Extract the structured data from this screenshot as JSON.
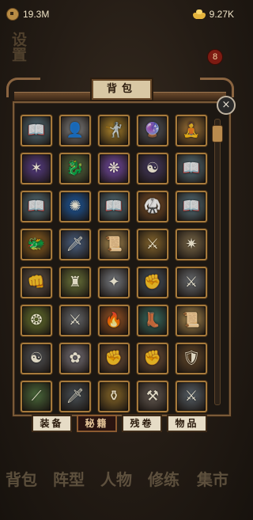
{
  "currency": {
    "copper": {
      "value": "19.3M",
      "icon": "copper-coin-icon"
    },
    "gold": {
      "value": "9.27K",
      "icon": "gold-ingot-icon"
    }
  },
  "background": {
    "left_label": "设置",
    "badge_count": "8"
  },
  "window": {
    "title": "背包",
    "close_glyph": "×"
  },
  "items": [
    {
      "icon": "open-book-icon",
      "glyph": "📖",
      "color": "#5e7b86"
    },
    {
      "icon": "white-figure-icon",
      "glyph": "👤",
      "color": "#8a8a8a"
    },
    {
      "icon": "dancing-warrior-icon",
      "glyph": "🤺",
      "color": "#b58b2e"
    },
    {
      "icon": "crystal-orb-icon",
      "glyph": "🔮",
      "color": "#5b5d63"
    },
    {
      "icon": "meditating-monk-icon",
      "glyph": "🧘",
      "color": "#a87a3a"
    },
    {
      "icon": "purple-claw-icon",
      "glyph": "✶",
      "color": "#5a3f8a"
    },
    {
      "icon": "green-dragon-icon",
      "glyph": "🐉",
      "color": "#5e7448"
    },
    {
      "icon": "purple-wings-icon",
      "glyph": "❋",
      "color": "#7a4fae"
    },
    {
      "icon": "dark-figure-icon",
      "glyph": "☯",
      "color": "#4a3e66"
    },
    {
      "icon": "open-book-icon",
      "glyph": "📖",
      "color": "#5e7b86"
    },
    {
      "icon": "open-book-icon",
      "glyph": "📖",
      "color": "#5e7b86"
    },
    {
      "icon": "blue-energy-icon",
      "glyph": "✺",
      "color": "#1f5ea8"
    },
    {
      "icon": "open-book-icon",
      "glyph": "📖",
      "color": "#5e7b86"
    },
    {
      "icon": "kicking-fighter-icon",
      "glyph": "🥋",
      "color": "#8a5a2e"
    },
    {
      "icon": "open-book-icon",
      "glyph": "📖",
      "color": "#5e7b86"
    },
    {
      "icon": "golden-dragon-icon",
      "glyph": "🐲",
      "color": "#9a6a24"
    },
    {
      "icon": "blue-sword-icon",
      "glyph": "🗡",
      "color": "#4d6384"
    },
    {
      "icon": "scroll-icon",
      "glyph": "📜",
      "color": "#b89658"
    },
    {
      "icon": "golden-warrior-icon",
      "glyph": "⚔",
      "color": "#8a6a30"
    },
    {
      "icon": "sword-burst-icon",
      "glyph": "✷",
      "color": "#7c6a4a"
    },
    {
      "icon": "shadow-fighter-icon",
      "glyph": "👊",
      "color": "#6b5d50"
    },
    {
      "icon": "jade-idol-icon",
      "glyph": "♜",
      "color": "#6f7a3e"
    },
    {
      "icon": "white-slash-icon",
      "glyph": "✦",
      "color": "#7a7e84"
    },
    {
      "icon": "steel-fist-icon",
      "glyph": "✊",
      "color": "#505c68"
    },
    {
      "icon": "crossed-swords-icon",
      "glyph": "⚔",
      "color": "#6b6e72"
    },
    {
      "icon": "green-emblem-icon",
      "glyph": "❂",
      "color": "#6c7a32"
    },
    {
      "icon": "crossed-swords-icon",
      "glyph": "⚔",
      "color": "#6b6e72"
    },
    {
      "icon": "fire-hand-icon",
      "glyph": "🔥",
      "color": "#a35a28"
    },
    {
      "icon": "jade-boot-icon",
      "glyph": "👢",
      "color": "#3c7468"
    },
    {
      "icon": "scroll-icon",
      "glyph": "📜",
      "color": "#b89658"
    },
    {
      "icon": "yin-yang-icon",
      "glyph": "☯",
      "color": "#55575a"
    },
    {
      "icon": "white-lotus-icon",
      "glyph": "✿",
      "color": "#7d7880"
    },
    {
      "icon": "clenched-fist-icon",
      "glyph": "✊",
      "color": "#7a5a40"
    },
    {
      "icon": "clenched-fist-icon",
      "glyph": "✊",
      "color": "#7a5a40"
    },
    {
      "icon": "armored-warrior-icon",
      "glyph": "🛡",
      "color": "#6a4e2e"
    },
    {
      "icon": "green-blade-icon",
      "glyph": "⟋",
      "color": "#4b6a3c"
    },
    {
      "icon": "ornate-sword-icon",
      "glyph": "🗡",
      "color": "#4a5258"
    },
    {
      "icon": "golden-vessel-icon",
      "glyph": "⚱",
      "color": "#8a6a2a"
    },
    {
      "icon": "war-hammer-icon",
      "glyph": "⚒",
      "color": "#6a6058"
    },
    {
      "icon": "steel-blade-icon",
      "glyph": "⚔",
      "color": "#5a646c"
    }
  ],
  "tabs": [
    {
      "label": "装备",
      "active": false
    },
    {
      "label": "秘籍",
      "active": true
    },
    {
      "label": "残卷",
      "active": false
    },
    {
      "label": "物品",
      "active": false
    }
  ],
  "bottom_nav": [
    {
      "label": "背包"
    },
    {
      "label": "阵型"
    },
    {
      "label": "人物"
    },
    {
      "label": "修练"
    },
    {
      "label": "集市"
    }
  ]
}
